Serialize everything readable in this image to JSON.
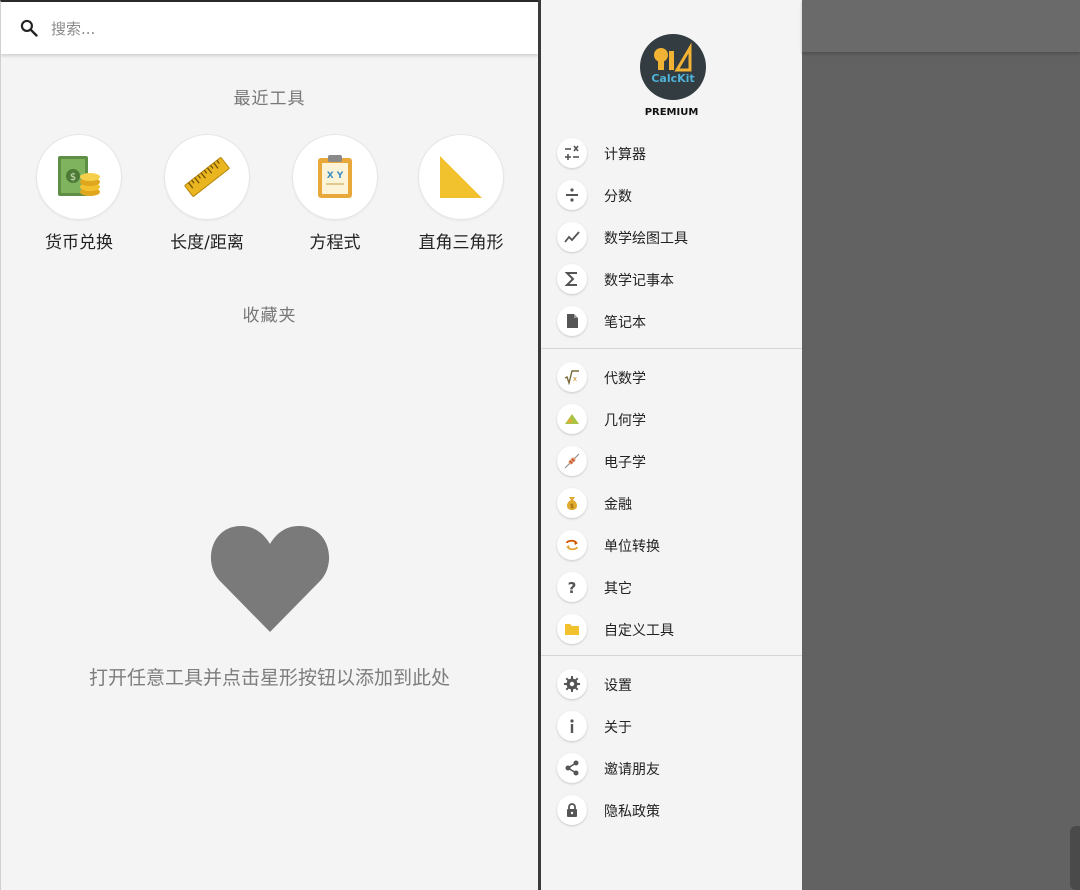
{
  "search": {
    "placeholder": "搜索..."
  },
  "recent": {
    "title": "最近工具",
    "tools": [
      {
        "label": "货币兑换",
        "icon": "money-icon"
      },
      {
        "label": "长度/距离",
        "icon": "ruler-icon"
      },
      {
        "label": "方程式",
        "icon": "clipboard-xy-icon"
      },
      {
        "label": "直角三角形",
        "icon": "right-triangle-icon"
      }
    ]
  },
  "favorites": {
    "title": "收藏夹",
    "empty_text": "打开任意工具并点击星形按钮以添加到此处",
    "icon": "heart-icon"
  },
  "drawer": {
    "logo_text": "CalcKit",
    "badge": "PREMIUM",
    "groups": [
      [
        {
          "label": "计算器",
          "icon": "calculator-icon"
        },
        {
          "label": "分数",
          "icon": "divide-icon"
        },
        {
          "label": "数学绘图工具",
          "icon": "chart-line-icon"
        },
        {
          "label": "数学记事本",
          "icon": "sigma-icon"
        },
        {
          "label": "笔记本",
          "icon": "document-icon"
        }
      ],
      [
        {
          "label": "代数学",
          "icon": "sqrt-icon"
        },
        {
          "label": "几何学",
          "icon": "geometry-icon"
        },
        {
          "label": "电子学",
          "icon": "resistor-icon"
        },
        {
          "label": "金融",
          "icon": "money-bag-icon"
        },
        {
          "label": "单位转换",
          "icon": "convert-icon"
        },
        {
          "label": "其它",
          "icon": "question-icon"
        },
        {
          "label": "自定义工具",
          "icon": "folder-icon"
        }
      ],
      [
        {
          "label": "设置",
          "icon": "gear-icon"
        },
        {
          "label": "关于",
          "icon": "info-icon"
        },
        {
          "label": "邀请朋友",
          "icon": "share-icon"
        },
        {
          "label": "隐私政策",
          "icon": "lock-icon"
        }
      ]
    ]
  },
  "colors": {
    "accent_yellow": "#f2c12e",
    "scrim": "#626262",
    "drawer_bg": "#f4f4f4",
    "logo_bg": "#333c40",
    "logo_text": "#4fb3d9"
  }
}
